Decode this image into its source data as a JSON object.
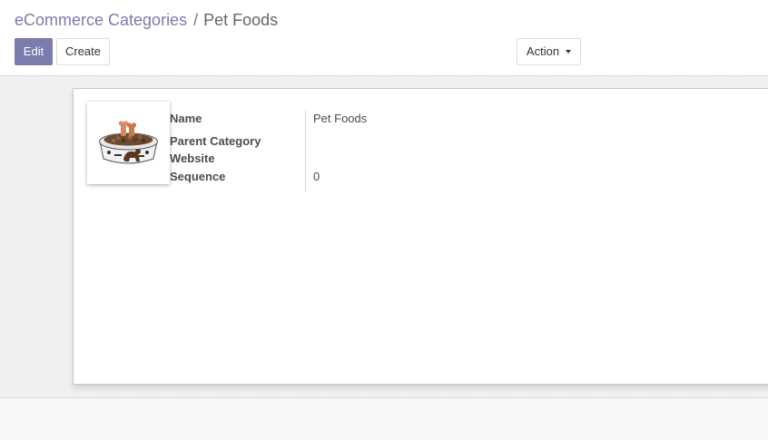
{
  "breadcrumb": {
    "parent": "eCommerce Categories",
    "separator": "/",
    "current": "Pet Foods"
  },
  "buttons": {
    "edit": "Edit",
    "create": "Create",
    "action": "Action"
  },
  "record": {
    "image_icon": "pet-food-bowl-image",
    "fields": [
      {
        "label": "Name",
        "value": "Pet Foods"
      },
      {
        "label": "Parent Category",
        "value": ""
      },
      {
        "label": "Website",
        "value": ""
      },
      {
        "label": "Sequence",
        "value": "0"
      }
    ]
  },
  "colors": {
    "primary": "#7c7bad",
    "text": "#4c4c4c"
  }
}
